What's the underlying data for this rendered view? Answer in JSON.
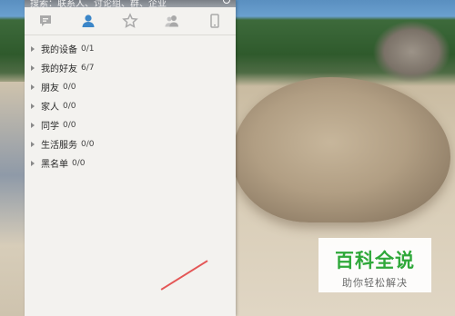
{
  "search": {
    "hint": "搜索：联系人、讨论组、群、企业"
  },
  "tabs": [
    {
      "name": "conversations",
      "icon": "chat-bubble-icon"
    },
    {
      "name": "contacts",
      "icon": "person-icon",
      "active": true
    },
    {
      "name": "favorites",
      "icon": "star-icon"
    },
    {
      "name": "groups",
      "icon": "group-icon"
    },
    {
      "name": "devices",
      "icon": "phone-icon"
    }
  ],
  "groups": [
    {
      "name": "我的设备",
      "count": "0/1"
    },
    {
      "name": "我的好友",
      "count": "6/7"
    },
    {
      "name": "朋友",
      "count": "0/0"
    },
    {
      "name": "家人",
      "count": "0/0"
    },
    {
      "name": "同学",
      "count": "0/0"
    },
    {
      "name": "生活服务",
      "count": "0/0"
    },
    {
      "name": "黑名单",
      "count": "0/0"
    }
  ],
  "watermark": {
    "title": "百科全说",
    "subtitle": "助你轻松解决"
  },
  "colors": {
    "accent": "#3b86c8",
    "panel_bg": "#f3f2ef",
    "watermark_green": "#2fa83a"
  }
}
